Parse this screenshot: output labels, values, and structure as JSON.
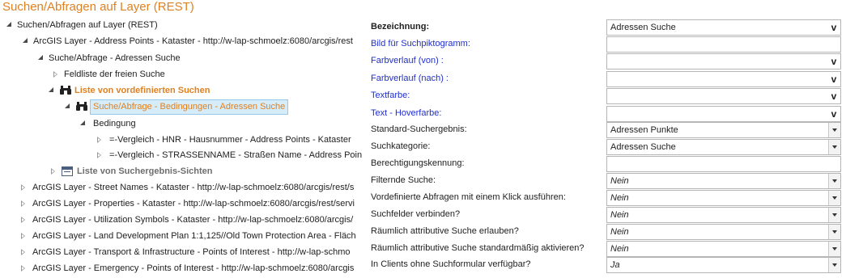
{
  "title": "Suchen/Abfragen auf Layer (REST)",
  "tree": {
    "root": "Suchen/Abfragen auf Layer (REST)",
    "layer_address_points": "ArcGIS Layer - Address Points - Kataster - http://w-lap-schmoelz:6080/arcgis/rest",
    "search_query": "Suche/Abfrage - Adressen Suche",
    "free_search_fields": "Feldliste der freien Suche",
    "predefined_searches": "Liste von vordefinierten Suchen",
    "selected_query": "Suche/Abfrage - Bedingungen - Adressen Suche",
    "condition": "Bedingung",
    "compare_1": "=-Vergleich - HNR - Hausnummer - Address Points - Kataster",
    "compare_2": "=-Vergleich - STRASSENNAME - Straßen Name - Address Poin",
    "result_views": "Liste von Suchergebnis-Sichten",
    "other_layers": [
      "ArcGIS Layer - Street Names - Kataster - http://w-lap-schmoelz:6080/arcgis/rest/s",
      "ArcGIS Layer - Properties - Kataster - http://w-lap-schmoelz:6080/arcgis/rest/servi",
      "ArcGIS Layer - Utilization Symbols - Kataster - http://w-lap-schmoelz:6080/arcgis/",
      "ArcGIS Layer - Land Development Plan 1:1,125//Old Town Protection Area - Fläch",
      "ArcGIS Layer - Transport & Infrastructure - Points of Interest - http://w-lap-schmo",
      "ArcGIS Layer - Emergency - Points of Interest - http://w-lap-schmoelz:6080/arcgis"
    ]
  },
  "props": [
    {
      "label": "Bezeichnung:",
      "value": "Adressen Suche",
      "control": "v"
    },
    {
      "label": "Bild für Suchpiktogramm:",
      "value": "",
      "control": "none"
    },
    {
      "label": "Farbverlauf (von) :",
      "value": "",
      "control": "v"
    },
    {
      "label": "Farbverlauf (nach) :",
      "value": "",
      "control": "v"
    },
    {
      "label": "Textfarbe:",
      "value": "",
      "control": "v"
    },
    {
      "label": "Text - Hoverfarbe:",
      "value": "",
      "control": "v"
    },
    {
      "label": "Standard-Suchergebnis:",
      "value": "Adressen Punkte",
      "control": "dropdown"
    },
    {
      "label": "Suchkategorie:",
      "value": "Adressen Suche",
      "control": "dropdown"
    },
    {
      "label": "Berechtigungskennung:",
      "value": "",
      "control": "none"
    },
    {
      "label": "Filternde Suche:",
      "value": "Nein",
      "control": "dropdown"
    },
    {
      "label": "Vordefinierte Abfragen mit einem Klick ausführen:",
      "value": "Nein",
      "control": "dropdown"
    },
    {
      "label": "Suchfelder verbinden?",
      "value": "Nein",
      "control": "dropdown"
    },
    {
      "label": "Räumlich attributive Suche erlauben?",
      "value": "Nein",
      "control": "dropdown"
    },
    {
      "label": "Räumlich attributive Suche standardmäßig aktivieren?",
      "value": "Nein",
      "control": "dropdown"
    },
    {
      "label": "In Clients ohne Suchformular verfügbar?",
      "value": "Ja",
      "control": "dropdown"
    }
  ],
  "v_label": "v",
  "colors": {
    "accent": "#e0801f",
    "link_blue": "#1f2fd0",
    "selection": "#d6ecf8"
  }
}
